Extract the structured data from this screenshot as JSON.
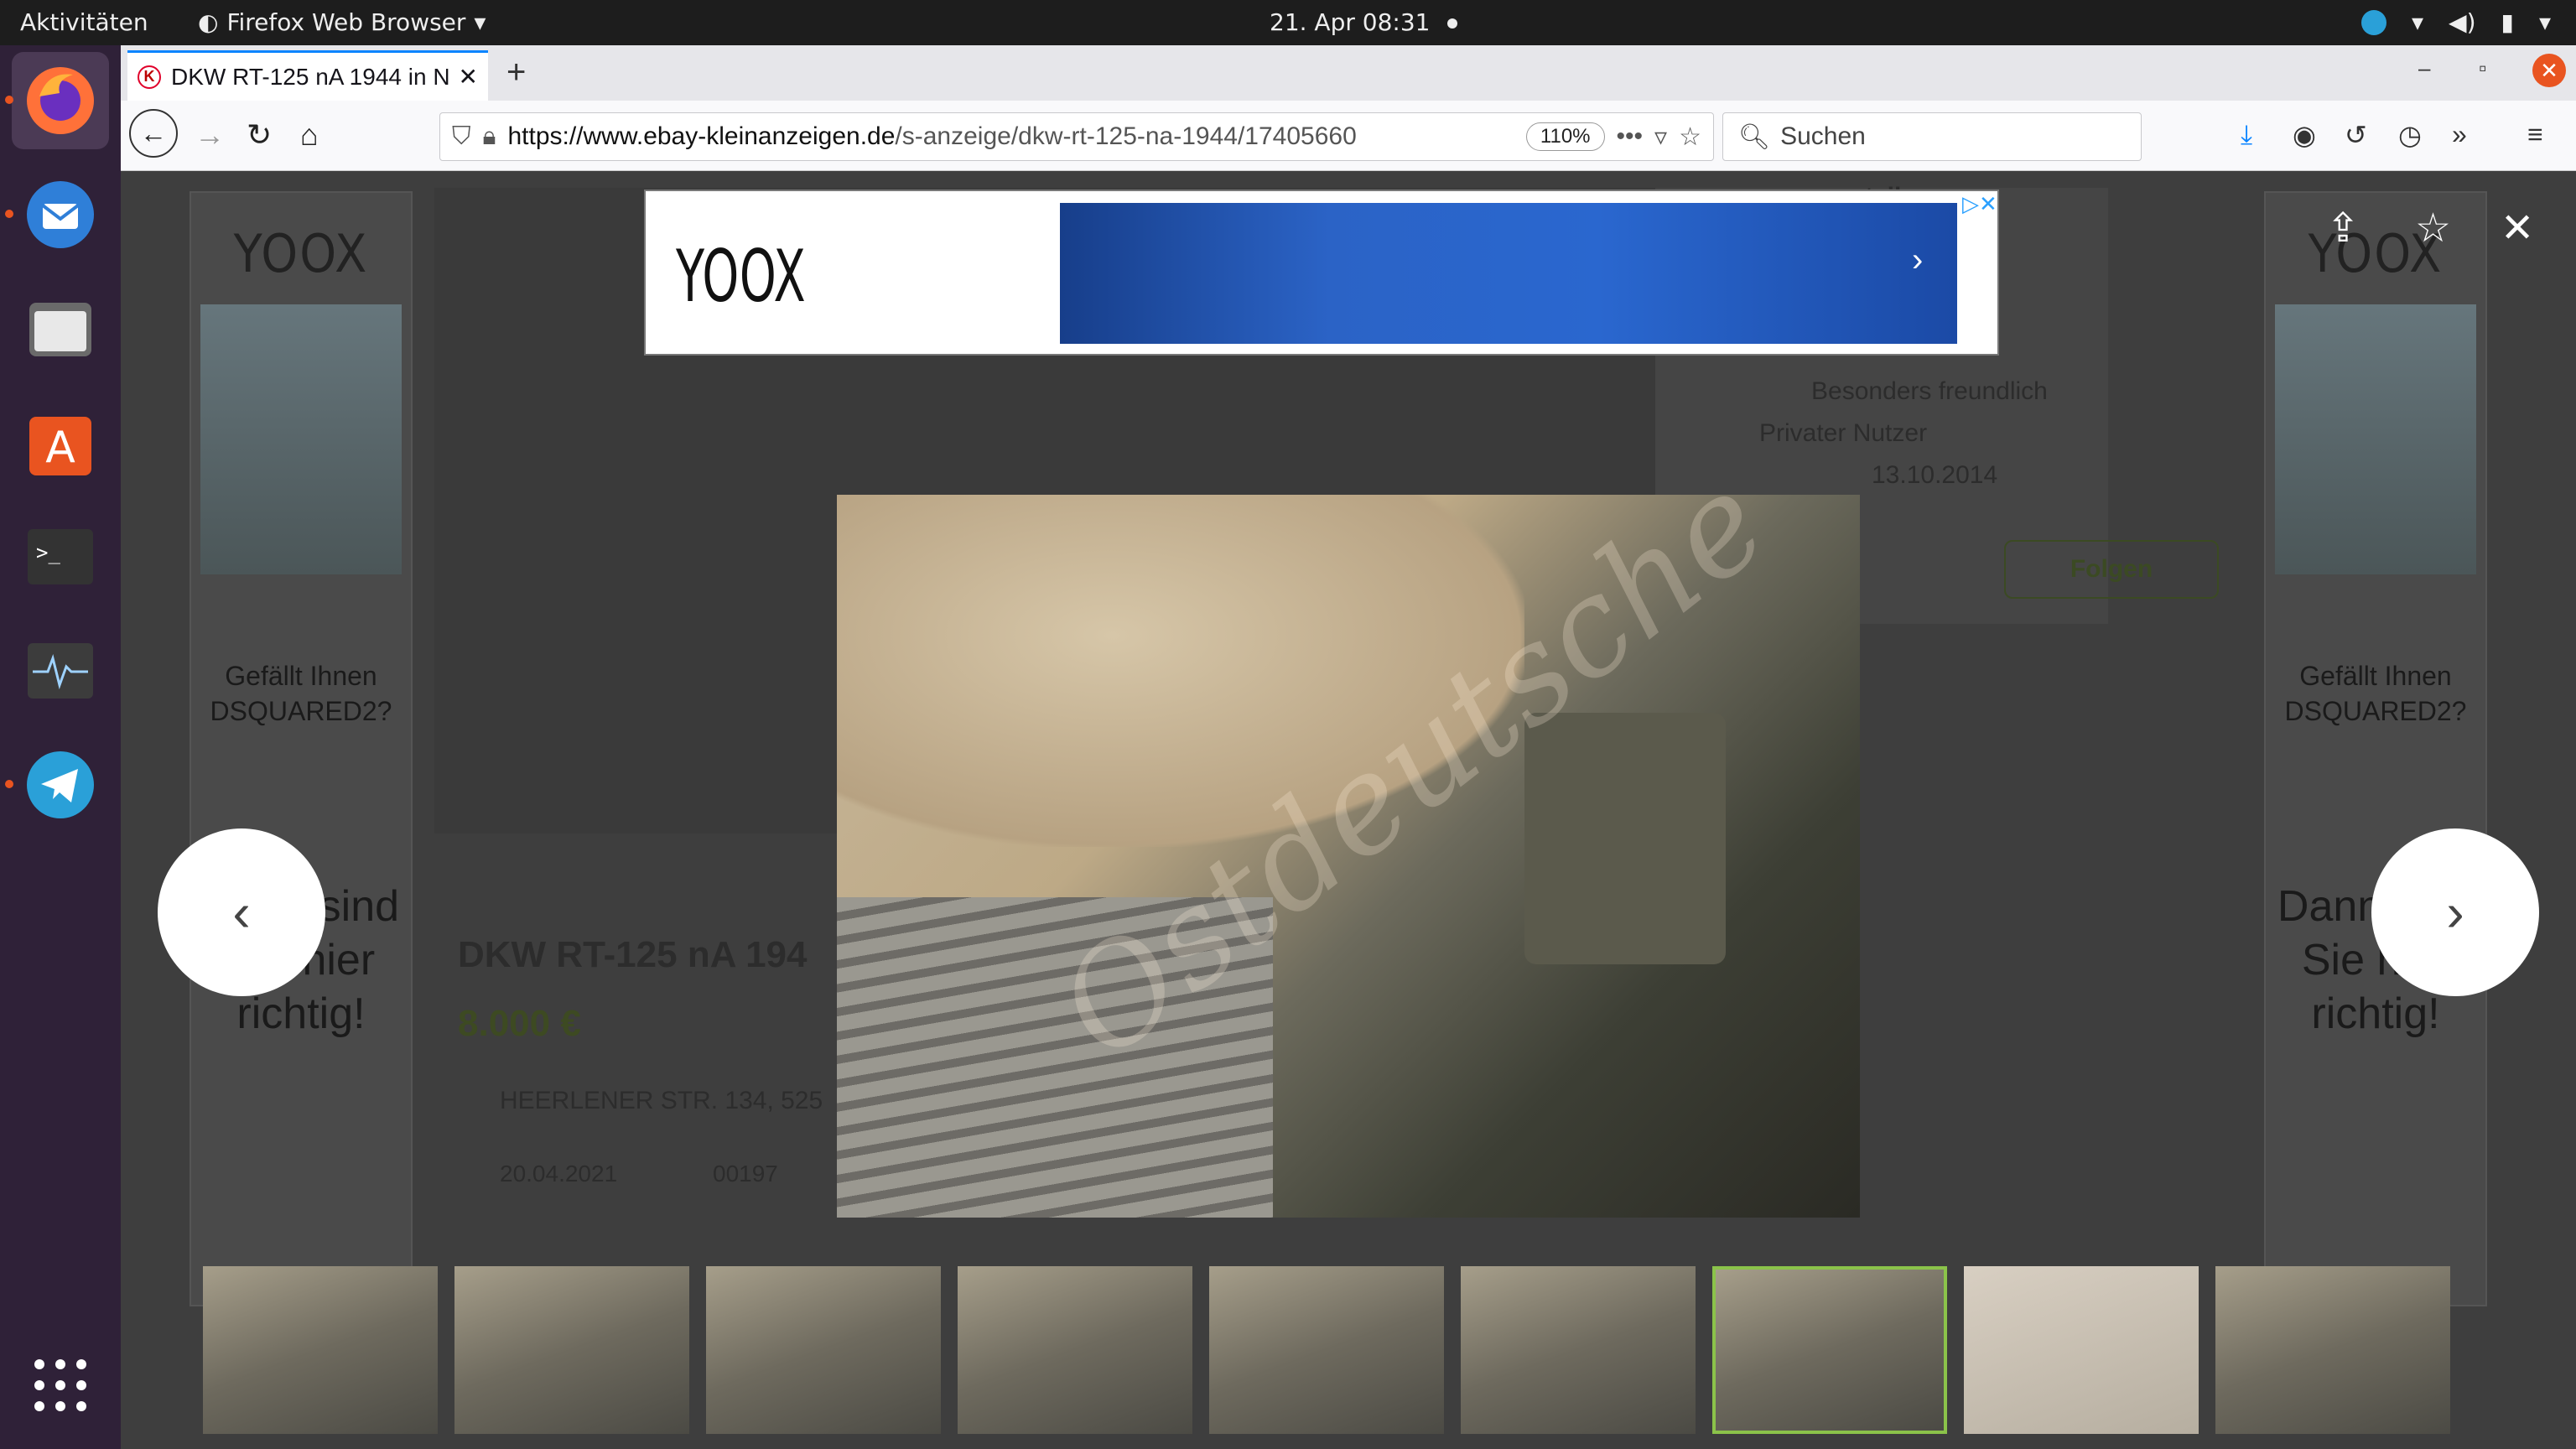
{
  "topbar": {
    "activities": "Aktivitäten",
    "app_name": "Firefox Web Browser",
    "clock": "21. Apr  08:31"
  },
  "browser": {
    "tab_title": "DKW RT-125 nA 1944 in N",
    "url_host": "https://www.ebay-kleinanzeigen.de",
    "url_path": "/s-anzeige/dkw-rt-125-na-1944/17405660",
    "zoom": "110%",
    "search_placeholder": "Suchen"
  },
  "listing": {
    "title": "DKW RT-125 nA 194",
    "price": "8.000 €",
    "address": "HEERLENER STR. 134, 525",
    "date": "20.04.2021",
    "views": "00197",
    "seller_badge": "Besonders freundlich",
    "seller_type": "Privater Nutzer",
    "since": "13.10.2014",
    "follow_label": "Folgen",
    "share_label": "teilen"
  },
  "ads": {
    "brand": "YOOX",
    "question": "Gefällt Ihnen DSQUARED2?",
    "tagline": "Dann sind Sie hier richtig!"
  },
  "lightbox": {
    "thumb_count": 9,
    "selected_index": 6
  }
}
